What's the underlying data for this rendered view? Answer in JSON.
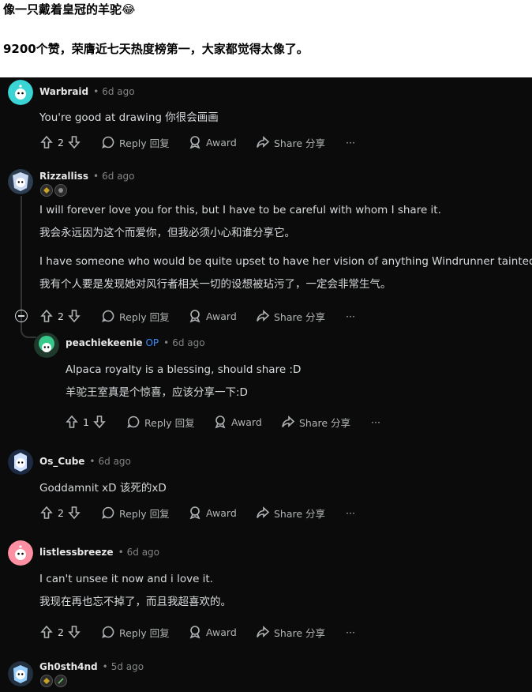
{
  "post": {
    "title": "像一只戴着皇冠的羊驼😂",
    "subtitle": "9200个赞，荣膺近七天热度榜第一，大家都觉得太像了。"
  },
  "labels": {
    "reply": "Reply 回复",
    "award": "Award",
    "share": "Share 分享",
    "more": "···",
    "op": "OP",
    "sep": "•"
  },
  "comments": [
    {
      "user": "Warbraid",
      "age": "6d ago",
      "lines": [
        "You're good at drawing 你很会画画"
      ],
      "votes": "2",
      "avatar_color": "#3ad4d4"
    },
    {
      "user": "Rizzalliss",
      "age": "6d ago",
      "lines": [
        "I will forever love you for this, but I have to be careful with whom I share it.",
        "我会永远因为这个而爱你，但我必须小心和谁分享它。",
        "I have someone who would be quite upset to have her vision of anything Windrunner tainted.",
        "我有个人要是发现她对风行者相关一切的设想被玷污了，一定会非常生气。"
      ],
      "votes": "2",
      "avatar_color": "#c8d8f0"
    },
    {
      "user": "peachiekeenie",
      "age": "6d ago",
      "op": true,
      "lines": [
        "Alpaca royalty is a blessing, should share :D",
        "羊驼王室真是个惊喜，应该分享一下:D"
      ],
      "votes": "1",
      "avatar_color": "#36c98a"
    },
    {
      "user": "Os_Cube",
      "age": "6d ago",
      "lines": [
        "Goddamnit xD 该死的xD"
      ],
      "votes": "2",
      "avatar_color": "#cfe0ff"
    },
    {
      "user": "listlessbreeze",
      "age": "6d ago",
      "lines": [
        "I can't unsee it now and i love it.",
        "我现在再也忘不掉了，而且我超喜欢的。"
      ],
      "votes": "2",
      "avatar_color": "#ff8fa3"
    },
    {
      "user": "Gh0sth4nd",
      "age": "5d ago",
      "lines": [],
      "votes": "",
      "avatar_color": "#9ad0ff"
    }
  ]
}
